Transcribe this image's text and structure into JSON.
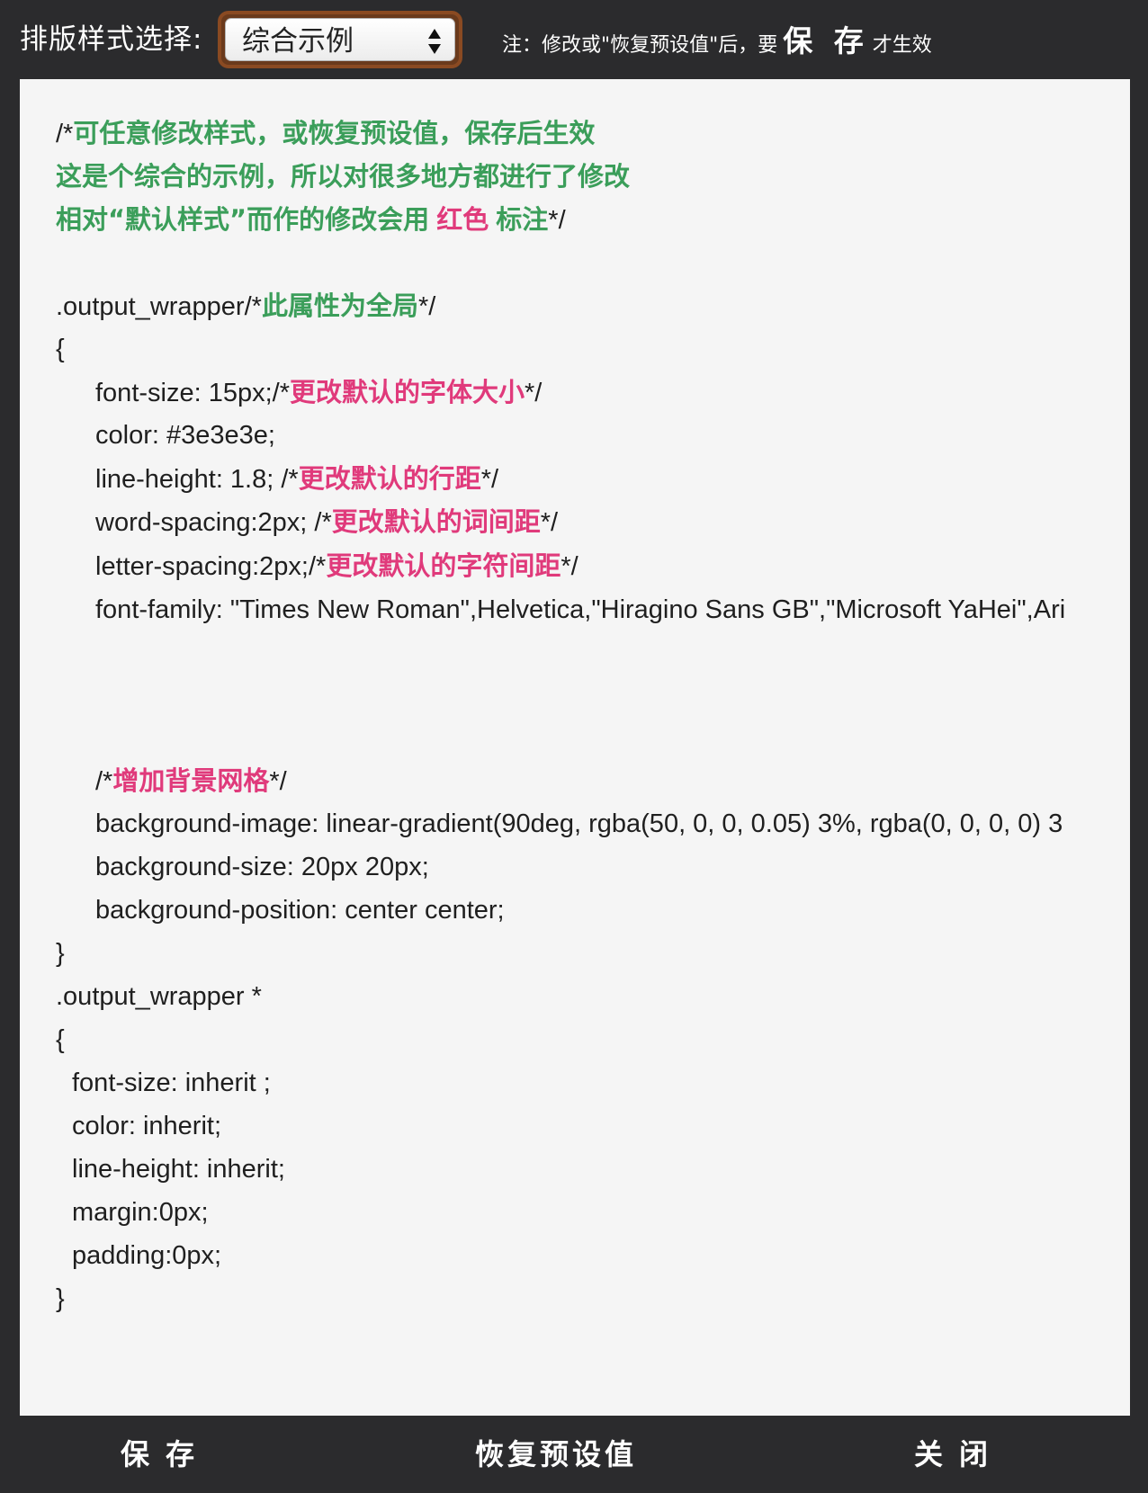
{
  "toolbar": {
    "style_label": "排版样式选择:",
    "selected_style": "综合示例",
    "notice_prefix": "注：修改或\"恢复预设值\"后，要",
    "notice_emph": "保 存",
    "notice_suffix": "才生效"
  },
  "code": {
    "l1_a": "/*",
    "l1_b": "可任意修改样式，或恢复预设值，保存后生效",
    "l2_b": "这是个综合的示例，所以对很多地方都进行了修改",
    "l3_b": "相对“默认样式”而作的修改会用",
    "l3_c": "红色",
    "l3_d": "标注",
    "l3_e": "*/",
    "l5_a": ".output_wrapper/*",
    "l5_b": "此属性为全局",
    "l5_c": "*/",
    "l6": "{",
    "l7_a": "font-size: 15px;/*",
    "l7_b": "更改默认的字体大小",
    "l7_c": "*/",
    "l8": "color: #3e3e3e;",
    "l9_a": "line-height: 1.8; /*",
    "l9_b": "更改默认的行距",
    "l9_c": "*/",
    "l10_a": "word-spacing:2px; /*",
    "l10_b": "更改默认的词间距",
    "l10_c": "*/",
    "l11_a": "letter-spacing:2px;/*",
    "l11_b": "更改默认的字符间距",
    "l11_c": "*/",
    "l12": "font-family: \"Times New Roman\",Helvetica,\"Hiragino Sans GB\",\"Microsoft YaHei\",Ari",
    "l16_a": "/*",
    "l16_b": "增加背景网格",
    "l16_c": "*/",
    "l17": "background-image: linear-gradient(90deg, rgba(50, 0, 0, 0.05) 3%, rgba(0, 0, 0, 0) 3",
    "l18": "background-size: 20px 20px;",
    "l19": "background-position: center center;",
    "l20": "}",
    "l21": ".output_wrapper *",
    "l22": "{",
    "l23": "font-size: inherit  ;",
    "l24": "color: inherit;",
    "l25": "line-height: inherit;",
    "l26": "margin:0px;",
    "l27": "padding:0px;",
    "l28": "}"
  },
  "footer": {
    "save": "保存",
    "reset": "恢复预设值",
    "close": "关闭"
  },
  "colors": {
    "comment_green": "#3b9e5a",
    "change_red": "#e03a7b",
    "editor_bg": "#f5f5f5",
    "chrome_bg": "#2b2b2d",
    "select_border": "#8a4a22"
  },
  "icons": {
    "select_arrows": "up-down-arrows-icon"
  }
}
